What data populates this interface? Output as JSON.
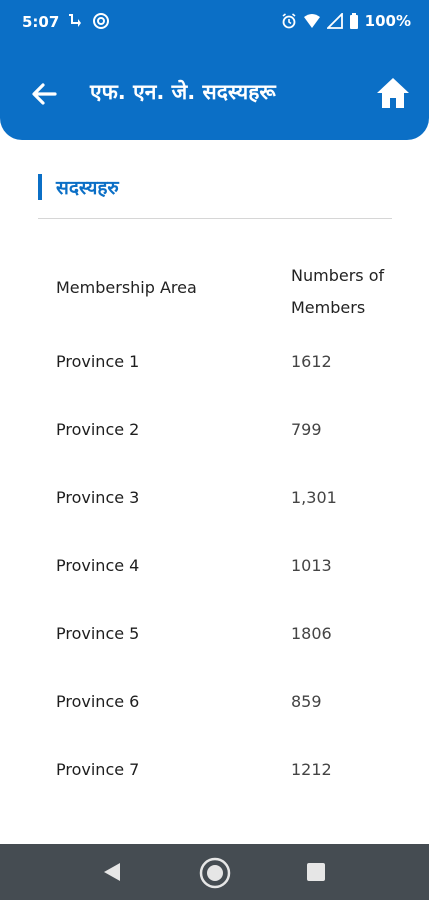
{
  "status_bar": {
    "time": "5:07",
    "battery": "100%",
    "icons": [
      "call-forward-icon",
      "sync-icon",
      "alarm-icon",
      "wifi-icon",
      "signal-icon",
      "battery-icon"
    ]
  },
  "app_bar": {
    "title": "एफ. एन. जे. सदस्यहरू",
    "back_icon": "arrow-left-icon",
    "home_icon": "home-icon"
  },
  "section": {
    "title": "सदस्यहरु"
  },
  "table": {
    "headers": {
      "area": "Membership Area",
      "members": "Numbers of Members"
    },
    "rows": [
      {
        "area": "Province 1",
        "members": "1612"
      },
      {
        "area": "Province 2",
        "members": "799"
      },
      {
        "area": "Province 3",
        "members": "1,301"
      },
      {
        "area": "Province 4",
        "members": "1013"
      },
      {
        "area": "Province 5",
        "members": "1806"
      },
      {
        "area": "Province 6",
        "members": "859"
      },
      {
        "area": "Province 7",
        "members": "1212"
      }
    ]
  },
  "colors": {
    "primary": "#0b6fc6",
    "navbar": "#454c52",
    "divider": "#d6d6d6"
  }
}
